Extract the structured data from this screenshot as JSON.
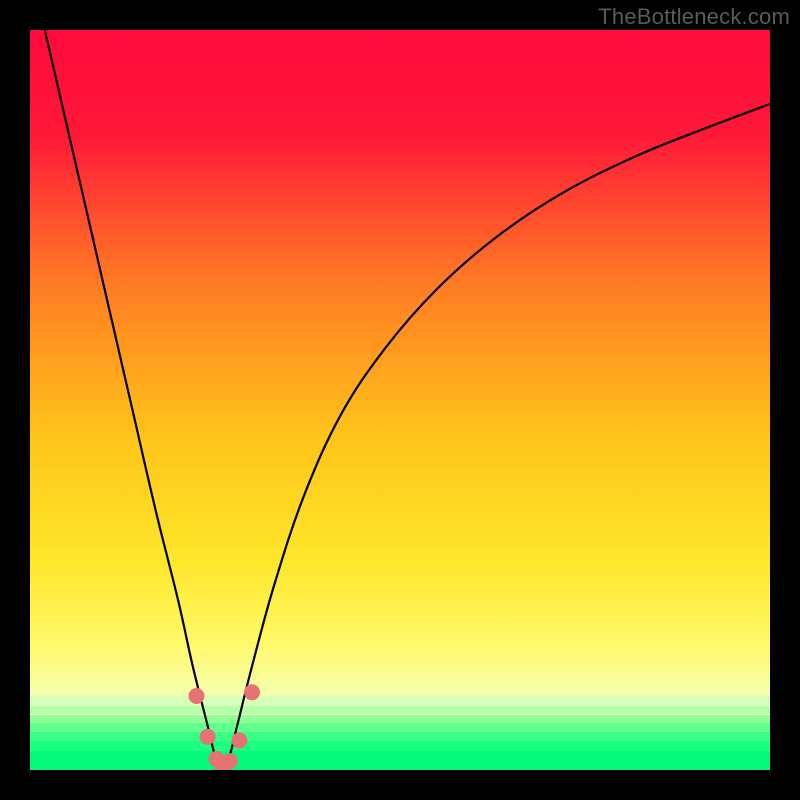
{
  "watermark": "TheBottleneck.com",
  "colors": {
    "frame": "#000000",
    "gradient_stops": [
      {
        "pct": 0,
        "color": "#ff0a3c"
      },
      {
        "pct": 14,
        "color": "#ff1838"
      },
      {
        "pct": 34,
        "color": "#ff7a24"
      },
      {
        "pct": 55,
        "color": "#ffc41a"
      },
      {
        "pct": 72,
        "color": "#ffe72a"
      },
      {
        "pct": 83,
        "color": "#fff96a"
      },
      {
        "pct": 90,
        "color": "#f6ffb0"
      }
    ],
    "green_bands": [
      {
        "top_pct": 90.0,
        "height_pct": 1.3,
        "color": "#d7ffb8"
      },
      {
        "top_pct": 91.3,
        "height_pct": 1.2,
        "color": "#b6ffa8"
      },
      {
        "top_pct": 92.5,
        "height_pct": 1.2,
        "color": "#8fff9a"
      },
      {
        "top_pct": 93.7,
        "height_pct": 1.2,
        "color": "#62ff8e"
      },
      {
        "top_pct": 94.9,
        "height_pct": 1.2,
        "color": "#3aff86"
      },
      {
        "top_pct": 96.1,
        "height_pct": 1.3,
        "color": "#1dff80"
      },
      {
        "top_pct": 97.4,
        "height_pct": 2.6,
        "color": "#06f97a"
      }
    ],
    "curve_stroke": "#000000",
    "marker_fill": "#e57373",
    "marker_radius": 8
  },
  "chart_data": {
    "type": "line",
    "title": "",
    "xlabel": "",
    "ylabel": "",
    "xlim": [
      0,
      100
    ],
    "ylim": [
      0,
      100
    ],
    "grid": false,
    "legend": false,
    "note": "x is horizontal position (0=left,100=right); y is bottleneck-like value (0=bottom/green,100=top/red). Curve dips to ~0 near x≈26 then rises again.",
    "series": [
      {
        "name": "curve",
        "x": [
          2,
          5,
          8,
          11,
          14,
          17,
          20,
          22,
          24,
          25,
          26,
          27,
          28,
          30,
          33,
          37,
          42,
          48,
          55,
          63,
          72,
          82,
          92,
          100
        ],
        "y": [
          100,
          87,
          74,
          61,
          48,
          35,
          23,
          14,
          6,
          2,
          0,
          2,
          6,
          14,
          25,
          37,
          48,
          57,
          65,
          72,
          78,
          83,
          87,
          90
        ]
      }
    ],
    "markers": {
      "name": "highlighted-points",
      "x": [
        22.5,
        24.0,
        25.2,
        26.0,
        27.0,
        28.3,
        30.0
      ],
      "y": [
        10.0,
        4.5,
        1.5,
        0.3,
        1.2,
        4.0,
        10.5
      ]
    }
  }
}
